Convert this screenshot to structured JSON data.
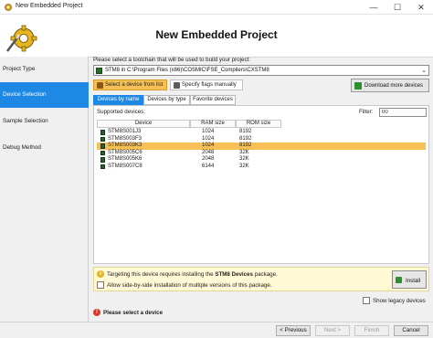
{
  "window": {
    "title": "New Embedded Project",
    "minimize_glyph": "—",
    "maximize_glyph": "☐",
    "close_glyph": "✕"
  },
  "header": {
    "heading": "New Embedded Project",
    "logo_icon": "gear-wand-icon"
  },
  "sidebar": {
    "items": [
      {
        "label": "Project Type",
        "active": false
      },
      {
        "label": "Device Selection",
        "active": true
      },
      {
        "label": "Sample Selection",
        "active": false
      },
      {
        "label": "Debug Method",
        "active": false
      }
    ]
  },
  "toolchain": {
    "prompt": "Please select a toolchain that will be used to build your project:",
    "selected": "STM8 in C:\\Program Files (x86)\\COSMIC\\FSE_Compilers\\CXSTM8",
    "arrow": "⌄"
  },
  "mode_buttons": {
    "select_from_list": "Select a device from list",
    "specify_flags": "Specify flags manually",
    "download_more": "Download more devices"
  },
  "tabs": [
    {
      "label": "Devices by name",
      "active": true
    },
    {
      "label": "Devices by type",
      "active": false
    },
    {
      "label": "Favorite devices",
      "active": false
    }
  ],
  "device_list": {
    "supported_label": "Supported devices:",
    "filter_label": "Filter:",
    "filter_value": "00",
    "columns": [
      "Device",
      "RAM size",
      "ROM size"
    ],
    "rows": [
      {
        "device": "STM8S001J3",
        "ram": "1024",
        "rom": "8192",
        "selected": false
      },
      {
        "device": "STM8S003F3",
        "ram": "1024",
        "rom": "8192",
        "selected": false
      },
      {
        "device": "STM8S003K3",
        "ram": "1024",
        "rom": "8192",
        "selected": true
      },
      {
        "device": "STM8S005C6",
        "ram": "2048",
        "rom": "32K",
        "selected": false
      },
      {
        "device": "STM8S005K6",
        "ram": "2048",
        "rom": "32K",
        "selected": false
      },
      {
        "device": "STM8S007C8",
        "ram": "6144",
        "rom": "32K",
        "selected": false
      }
    ]
  },
  "notice": {
    "info_glyph": "i",
    "msg_prefix": "Targeting this device requires installing the ",
    "msg_package": "STM8 Devices",
    "msg_suffix": " package.",
    "side_by_side": "Allow side-by-side installation of multiple versions of this package.",
    "install_label": "Install"
  },
  "legacy": {
    "label": "Show legacy devices"
  },
  "status": {
    "error_glyph": "!",
    "error_text": "Please select a device"
  },
  "footer": {
    "previous": "< Previous",
    "next": "Next >",
    "finish": "Finish",
    "cancel": "Cancel"
  },
  "colors": {
    "accent": "#1e88e5",
    "selection": "#f6c056"
  }
}
